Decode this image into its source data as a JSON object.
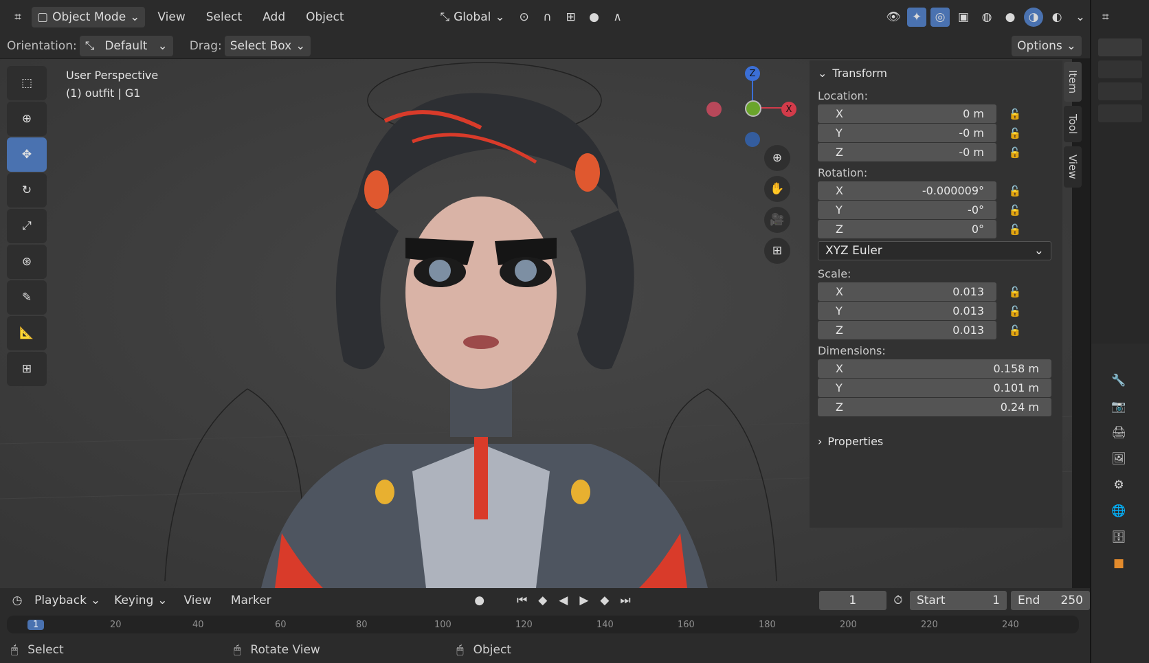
{
  "header": {
    "mode": "Object Mode",
    "menus": [
      "View",
      "Select",
      "Add",
      "Object"
    ],
    "orientation_global": "Global"
  },
  "toolbar": {
    "orientation_label": "Orientation:",
    "orientation_value": "Default",
    "drag_label": "Drag:",
    "drag_value": "Select Box",
    "options": "Options"
  },
  "viewport": {
    "view_name": "User Perspective",
    "object_info": "(1) outfit | G1"
  },
  "gizmo": {
    "z": "Z",
    "x": "X"
  },
  "npanel": {
    "transform_title": "Transform",
    "location_label": "Location:",
    "location": [
      {
        "axis": "X",
        "value": "0 m"
      },
      {
        "axis": "Y",
        "value": "-0 m"
      },
      {
        "axis": "Z",
        "value": "-0 m"
      }
    ],
    "rotation_label": "Rotation:",
    "rotation": [
      {
        "axis": "X",
        "value": "-0.000009°"
      },
      {
        "axis": "Y",
        "value": "-0°"
      },
      {
        "axis": "Z",
        "value": "0°"
      }
    ],
    "rotation_mode": "XYZ Euler",
    "scale_label": "Scale:",
    "scale": [
      {
        "axis": "X",
        "value": "0.013"
      },
      {
        "axis": "Y",
        "value": "0.013"
      },
      {
        "axis": "Z",
        "value": "0.013"
      }
    ],
    "dimensions_label": "Dimensions:",
    "dimensions": [
      {
        "axis": "X",
        "value": "0.158 m"
      },
      {
        "axis": "Y",
        "value": "0.101 m"
      },
      {
        "axis": "Z",
        "value": "0.24 m"
      }
    ],
    "properties_title": "Properties",
    "tabs": [
      "Item",
      "Tool",
      "View"
    ]
  },
  "timeline": {
    "menus": [
      "Playback",
      "Keying",
      "View",
      "Marker"
    ],
    "current_frame": "1",
    "start_label": "Start",
    "start_value": "1",
    "end_label": "End",
    "end_value": "250",
    "ruler": [
      "1",
      "20",
      "40",
      "60",
      "80",
      "100",
      "120",
      "140",
      "160",
      "180",
      "200",
      "220",
      "240"
    ]
  },
  "status": {
    "select": "Select",
    "rotate": "Rotate View",
    "object": "Object"
  }
}
